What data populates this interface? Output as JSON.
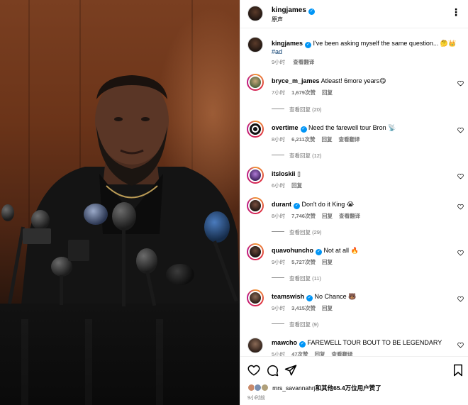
{
  "post": {
    "author": "kingjames",
    "subtitle": "原声",
    "caption_author": "kingjames",
    "caption_text": "I've been asking myself the same question... 🤔👑",
    "hashtag": "#ad",
    "caption_time": "9小时",
    "caption_translate": "查看翻译"
  },
  "comments": [
    {
      "user": "bryce_m_james",
      "verified": false,
      "text": "Atleast! 6more years😋",
      "time": "7小时",
      "likes": "1,679次赞",
      "reply": "回复",
      "translate": "",
      "view_replies": "查看回复 (20)"
    },
    {
      "user": "overtime",
      "verified": true,
      "text": "Need the farewell tour Bron 📡",
      "time": "8小时",
      "likes": "6,211次赞",
      "reply": "回复",
      "translate": "查看翻译",
      "view_replies": "查看回复 (12)"
    },
    {
      "user": "itsloskii",
      "verified": false,
      "text": "▯",
      "time": "6小时",
      "likes": "",
      "reply": "回复",
      "translate": "",
      "view_replies": ""
    },
    {
      "user": "durant",
      "verified": true,
      "text": "Don't do it King 😭",
      "time": "8小时",
      "likes": "7,746次赞",
      "reply": "回复",
      "translate": "查看翻译",
      "view_replies": "查看回复 (29)"
    },
    {
      "user": "quavohuncho",
      "verified": true,
      "text": "Not at all 🔥",
      "time": "9小时",
      "likes": "5,727次赞",
      "reply": "回复",
      "translate": "",
      "view_replies": "查看回复 (11)"
    },
    {
      "user": "teamswish",
      "verified": true,
      "text": "No Chance 🐻",
      "time": "9小时",
      "likes": "3,415次赞",
      "reply": "回复",
      "translate": "",
      "view_replies": "查看回复 (9)"
    },
    {
      "user": "mawcho",
      "verified": true,
      "text": "FAREWELL TOUR BOUT TO BE LEGENDARY",
      "time": "5小时",
      "likes": "47次赞",
      "reply": "回复",
      "translate": "查看翻译",
      "view_replies": ""
    }
  ],
  "footer": {
    "likes_user": "mrs_savannahrj",
    "likes_text": "和其他65.4万位用户赞了",
    "time": "9小时前"
  },
  "icons": {
    "more": "more-options-icon",
    "heart": "heart-icon",
    "comment": "comment-icon",
    "share": "share-icon",
    "bookmark": "bookmark-icon",
    "verified": "verified-badge-icon"
  },
  "colors": {
    "verified": "#0095f6",
    "muted": "#737373",
    "hashtag": "#00376b",
    "border": "#efefef"
  }
}
